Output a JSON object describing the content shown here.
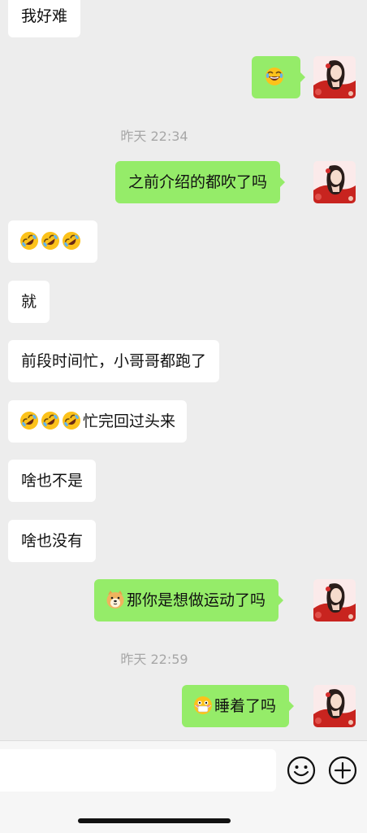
{
  "messages": [
    {
      "text": "我好难"
    },
    {
      "emoji": "tears-of-joy-emoji"
    },
    {
      "text": "之前介绍的都吹了吗"
    },
    {
      "emoji": "crying-laughing-emoji"
    },
    {
      "text": "就"
    },
    {
      "text": "前段时间忙，小哥哥都跑了"
    },
    {
      "text": "忙完回过头来",
      "emoji": "crying-laughing-emoji"
    },
    {
      "text": "啥也不是"
    },
    {
      "text": "啥也没有"
    },
    {
      "text": "那你是想做运动了吗",
      "emoji": "doge-emoji"
    },
    {
      "text": "睡着了吗",
      "emoji": "flushed-mask-emoji"
    }
  ],
  "timestamps": [
    "昨天 22:34",
    "昨天 22:59"
  ],
  "input": {
    "placeholder": ""
  },
  "icons": {
    "emoji_button": "smiley-icon",
    "more_button": "plus-circle-icon"
  },
  "colors": {
    "background": "#ededed",
    "outgoing_bubble": "#95ec69",
    "incoming_bubble": "#ffffff",
    "timestamp": "#a7a7a7"
  }
}
